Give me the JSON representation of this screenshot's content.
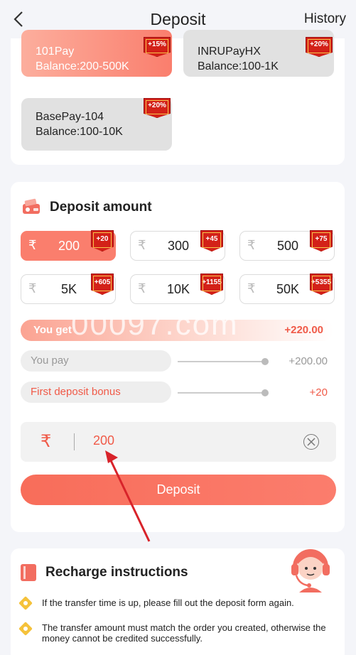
{
  "header": {
    "title": "Deposit",
    "history_label": "History"
  },
  "channels": [
    {
      "name": "101Pay",
      "balance": "Balance:200-500K",
      "tag": "+15%"
    },
    {
      "name": "INRUPayHX",
      "balance": "Balance:100-1K",
      "tag": "+20%"
    },
    {
      "name": "BasePay-104",
      "balance": "Balance:100-10K",
      "tag": "+20%"
    }
  ],
  "deposit": {
    "title": "Deposit amount",
    "currency_symbol": "₹",
    "amounts": [
      {
        "value": "200",
        "bonus": "+20"
      },
      {
        "value": "300",
        "bonus": "+45"
      },
      {
        "value": "500",
        "bonus": "+75"
      },
      {
        "value": "5K",
        "bonus": "+605"
      },
      {
        "value": "10K",
        "bonus": "+1155"
      },
      {
        "value": "50K",
        "bonus": "+5355"
      }
    ],
    "you_get_label": "You get",
    "you_get_value": "+220.00",
    "you_pay_label": "You pay",
    "you_pay_value": "+200.00",
    "bonus_label": "First deposit bonus",
    "bonus_value": "+20",
    "input_value": "200",
    "button_label": "Deposit"
  },
  "watermark": "00097.com",
  "instructions": {
    "title": "Recharge instructions",
    "items": [
      "If the transfer time is up, please fill out the deposit form again.",
      "The transfer amount must match the order you created, otherwise the money cannot be credited successfully."
    ]
  },
  "colors": {
    "accent": "#fa7e6d",
    "tag": "#d32118",
    "bullet": "#f5c23b"
  }
}
